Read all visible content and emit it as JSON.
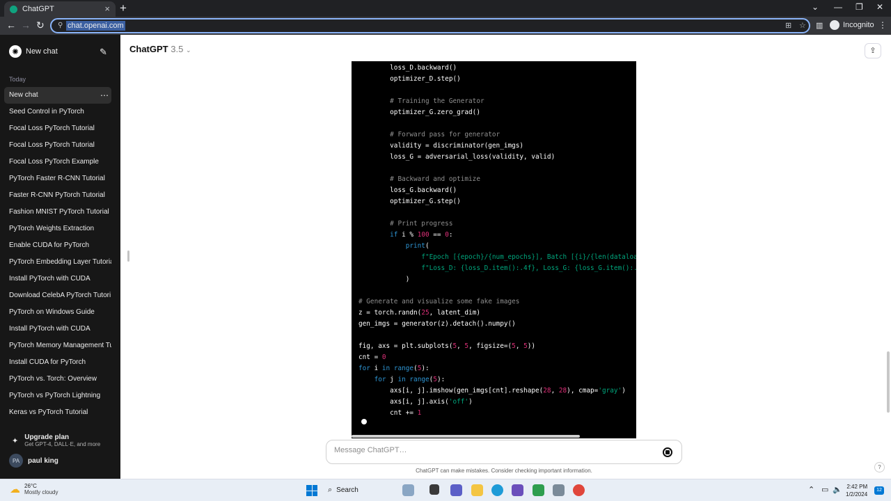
{
  "browser": {
    "tab_title": "ChatGPT",
    "url": "chat.openai.com",
    "incognito_label": "Incognito"
  },
  "sidebar": {
    "new_chat_label": "New chat",
    "section_today": "Today",
    "items": [
      {
        "label": "New chat"
      },
      {
        "label": "Seed Control in PyTorch"
      },
      {
        "label": "Focal Loss PyTorch Tutorial"
      },
      {
        "label": "Focal Loss PyTorch Tutorial"
      },
      {
        "label": "Focal Loss PyTorch Example"
      },
      {
        "label": "PyTorch Faster R-CNN Tutorial"
      },
      {
        "label": "Faster R-CNN PyTorch Tutorial"
      },
      {
        "label": "Fashion MNIST PyTorch Tutorial"
      },
      {
        "label": "PyTorch Weights Extraction"
      },
      {
        "label": "Enable CUDA for PyTorch"
      },
      {
        "label": "PyTorch Embedding Layer Tutoria"
      },
      {
        "label": "Install PyTorch with CUDA"
      },
      {
        "label": "Download CelebA PyTorch Tutori"
      },
      {
        "label": "PyTorch on Windows Guide"
      },
      {
        "label": "Install PyTorch with CUDA"
      },
      {
        "label": "PyTorch Memory Management Tu"
      },
      {
        "label": "Install CUDA for PyTorch"
      },
      {
        "label": "PyTorch vs. Torch: Overview"
      },
      {
        "label": "PyTorch vs PyTorch Lightning"
      },
      {
        "label": "Keras vs PyTorch Tutorial"
      }
    ],
    "upgrade_title": "Upgrade plan",
    "upgrade_subtitle": "Get GPT-4, DALL·E, and more",
    "user_initials": "PA",
    "user_name": "paul king"
  },
  "main": {
    "model_name": "ChatGPT",
    "model_version": "3.5",
    "composer_placeholder": "Message ChatGPT…",
    "disclaimer": "ChatGPT can make mistakes. Consider checking important information.",
    "help_label": "?"
  },
  "code": {
    "lines": [
      [
        {
          "t": "        loss_D.backward()"
        }
      ],
      [
        {
          "t": "        optimizer_D.step()"
        }
      ],
      [
        {
          "t": ""
        }
      ],
      [
        {
          "t": "        "
        },
        {
          "t": "# Training the Generator",
          "c": "c"
        }
      ],
      [
        {
          "t": "        optimizer_G.zero_grad()"
        }
      ],
      [
        {
          "t": ""
        }
      ],
      [
        {
          "t": "        "
        },
        {
          "t": "# Forward pass for generator",
          "c": "c"
        }
      ],
      [
        {
          "t": "        validity = discriminator(gen_imgs)"
        }
      ],
      [
        {
          "t": "        loss_G = adversarial_loss(validity, valid)"
        }
      ],
      [
        {
          "t": ""
        }
      ],
      [
        {
          "t": "        "
        },
        {
          "t": "# Backward and optimize",
          "c": "c"
        }
      ],
      [
        {
          "t": "        loss_G.backward()"
        }
      ],
      [
        {
          "t": "        optimizer_G.step()"
        }
      ],
      [
        {
          "t": ""
        }
      ],
      [
        {
          "t": "        "
        },
        {
          "t": "# Print progress",
          "c": "c"
        }
      ],
      [
        {
          "t": "        "
        },
        {
          "t": "if",
          "c": "k"
        },
        {
          "t": " i % "
        },
        {
          "t": "100",
          "c": "n"
        },
        {
          "t": " == "
        },
        {
          "t": "0",
          "c": "n"
        },
        {
          "t": ":"
        }
      ],
      [
        {
          "t": "            "
        },
        {
          "t": "print",
          "c": "k"
        },
        {
          "t": "("
        }
      ],
      [
        {
          "t": "                "
        },
        {
          "t": "f\"Epoch [{epoch}/{num_epochs}], Batch [{i}/{len(dataloa",
          "c": "s"
        }
      ],
      [
        {
          "t": "                "
        },
        {
          "t": "f\"Loss_D: {loss_D.item():.4f}, Loss_G: {loss_G.item():.",
          "c": "s"
        }
      ],
      [
        {
          "t": "            )"
        }
      ],
      [
        {
          "t": ""
        }
      ],
      [
        {
          "t": "# Generate and visualize some fake images",
          "c": "c"
        }
      ],
      [
        {
          "t": "z = torch.randn("
        },
        {
          "t": "25",
          "c": "n"
        },
        {
          "t": ", latent_dim)"
        }
      ],
      [
        {
          "t": "gen_imgs = generator(z).detach().numpy()"
        }
      ],
      [
        {
          "t": ""
        }
      ],
      [
        {
          "t": "fig, axs = plt.subplots("
        },
        {
          "t": "5",
          "c": "n"
        },
        {
          "t": ", "
        },
        {
          "t": "5",
          "c": "n"
        },
        {
          "t": ", figsize=("
        },
        {
          "t": "5",
          "c": "n"
        },
        {
          "t": ", "
        },
        {
          "t": "5",
          "c": "n"
        },
        {
          "t": "))"
        }
      ],
      [
        {
          "t": "cnt = "
        },
        {
          "t": "0",
          "c": "n"
        }
      ],
      [
        {
          "t": "for",
          "c": "k"
        },
        {
          "t": " i "
        },
        {
          "t": "in",
          "c": "k"
        },
        {
          "t": " "
        },
        {
          "t": "range",
          "c": "k"
        },
        {
          "t": "("
        },
        {
          "t": "5",
          "c": "n"
        },
        {
          "t": "):"
        }
      ],
      [
        {
          "t": "    "
        },
        {
          "t": "for",
          "c": "k"
        },
        {
          "t": " j "
        },
        {
          "t": "in",
          "c": "k"
        },
        {
          "t": " "
        },
        {
          "t": "range",
          "c": "k"
        },
        {
          "t": "("
        },
        {
          "t": "5",
          "c": "n"
        },
        {
          "t": "):"
        }
      ],
      [
        {
          "t": "        axs[i, j].imshow(gen_imgs[cnt].reshape("
        },
        {
          "t": "28",
          "c": "n"
        },
        {
          "t": ", "
        },
        {
          "t": "28",
          "c": "n"
        },
        {
          "t": "), cmap="
        },
        {
          "t": "'gray'",
          "c": "s"
        },
        {
          "t": ")"
        }
      ],
      [
        {
          "t": "        axs[i, j].axis("
        },
        {
          "t": "'off'",
          "c": "s"
        },
        {
          "t": ")"
        }
      ],
      [
        {
          "t": "        cnt += "
        },
        {
          "t": "1",
          "c": "n"
        }
      ]
    ]
  },
  "taskbar": {
    "temperature": "26°C",
    "condition": "Mostly cloudy",
    "search_label": "Search",
    "time": "2:42 PM",
    "date": "1/2/2024",
    "notification_count": "12"
  }
}
